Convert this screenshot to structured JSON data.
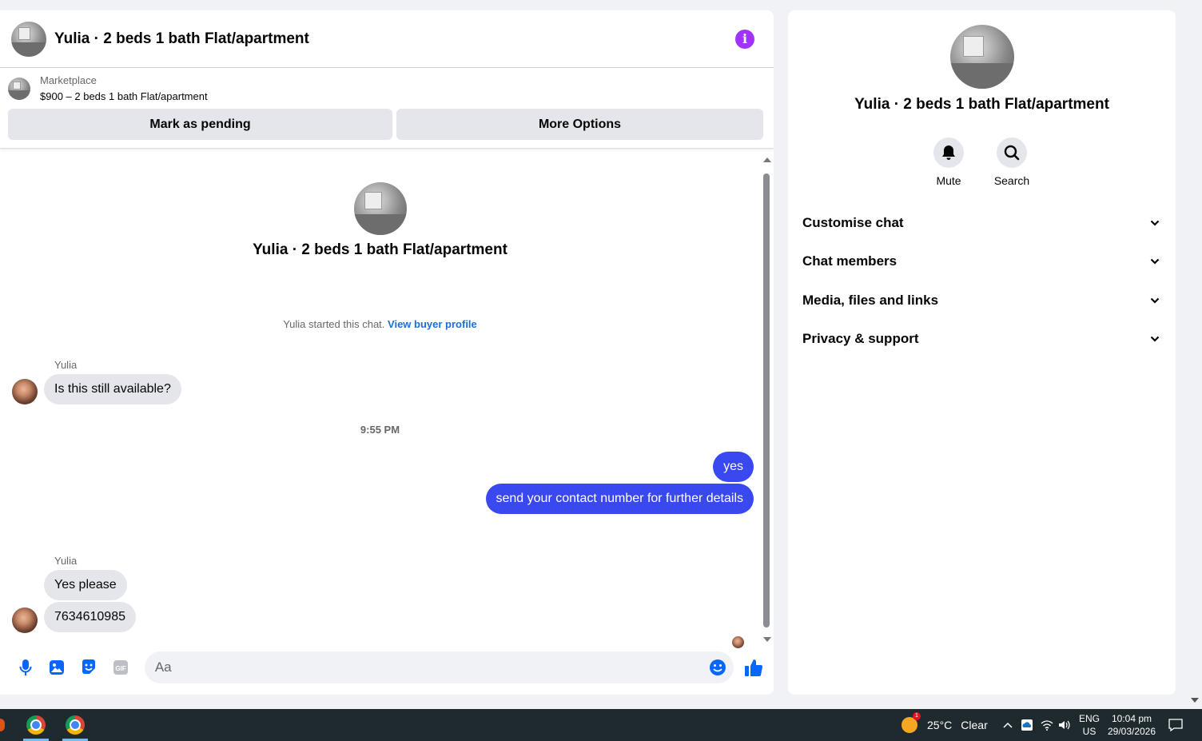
{
  "chat": {
    "title": "Yulia · 2 beds 1 bath Flat/apartment",
    "info_icon": "info-icon",
    "marketplace": {
      "label": "Marketplace",
      "listing": "$900 – 2 beds 1 bath Flat/apartment",
      "actions": {
        "pending": "Mark as pending",
        "more": "More Options"
      }
    },
    "intro": {
      "title": "Yulia · 2 beds 1 bath Flat/apartment",
      "started_text": "Yulia started this chat.",
      "profile_link": "View buyer profile"
    },
    "messages": [
      {
        "sender": "Yulia",
        "text": "Is this still available?"
      },
      {
        "timestamp": "9:55 PM"
      },
      {
        "sender": "me",
        "text": "yes"
      },
      {
        "sender": "me",
        "text": "send your contact number for further details"
      },
      {
        "sender": "Yulia",
        "text": "Yes please"
      },
      {
        "sender": "Yulia",
        "text": "7634610985"
      }
    ],
    "composer": {
      "placeholder": "Aa",
      "icons": [
        "microphone-icon",
        "image-icon",
        "sticker-icon",
        "gif-icon",
        "emoji-icon",
        "thumbs-up-icon"
      ],
      "gif_label": "GIF"
    },
    "accent": "#3a48f0"
  },
  "info_panel": {
    "title": "Yulia · 2 beds 1 bath Flat/apartment",
    "actions": [
      {
        "label": "Mute",
        "icon": "bell-icon"
      },
      {
        "label": "Search",
        "icon": "search-icon"
      }
    ],
    "sections": [
      "Customise chat",
      "Chat members",
      "Media, files and links",
      "Privacy & support"
    ]
  },
  "taskbar": {
    "weather": {
      "temp": "25°C",
      "condition": "Clear"
    },
    "language": {
      "line1": "ENG",
      "line2": "US"
    },
    "clock": {
      "time": "10:04 pm",
      "date": "29/03/2026"
    }
  }
}
